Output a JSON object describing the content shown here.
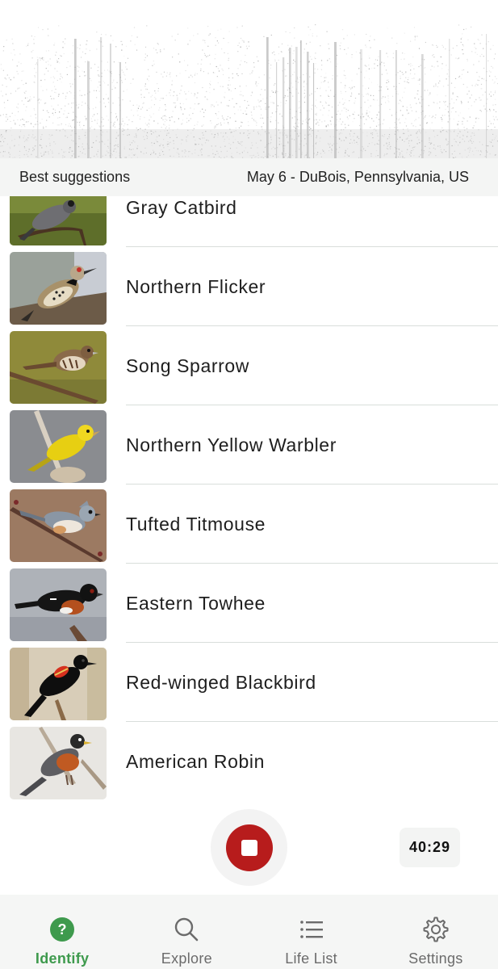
{
  "suggestions": {
    "label": "Best suggestions",
    "context": "May 6 - DuBois, Pennsylvania, US"
  },
  "species": [
    {
      "name": "Gray Catbird",
      "thumb_icon": "gray-catbird-photo"
    },
    {
      "name": "Northern Flicker",
      "thumb_icon": "northern-flicker-photo"
    },
    {
      "name": "Song Sparrow",
      "thumb_icon": "song-sparrow-photo"
    },
    {
      "name": "Northern Yellow Warbler",
      "thumb_icon": "yellow-warbler-photo"
    },
    {
      "name": "Tufted Titmouse",
      "thumb_icon": "tufted-titmouse-photo"
    },
    {
      "name": "Eastern Towhee",
      "thumb_icon": "eastern-towhee-photo"
    },
    {
      "name": "Red-winged Blackbird",
      "thumb_icon": "red-winged-blackbird-photo"
    },
    {
      "name": "American Robin",
      "thumb_icon": "american-robin-photo"
    }
  ],
  "recorder": {
    "timer": "40:29",
    "record_color": "#b71c1c"
  },
  "nav": {
    "items": [
      {
        "label": "Identify",
        "icon": "question-circle-icon",
        "active": true
      },
      {
        "label": "Explore",
        "icon": "search-icon",
        "active": false
      },
      {
        "label": "Life List",
        "icon": "list-icon",
        "active": false
      },
      {
        "label": "Settings",
        "icon": "gear-icon",
        "active": false
      }
    ],
    "active_color": "#3e9a4d"
  }
}
